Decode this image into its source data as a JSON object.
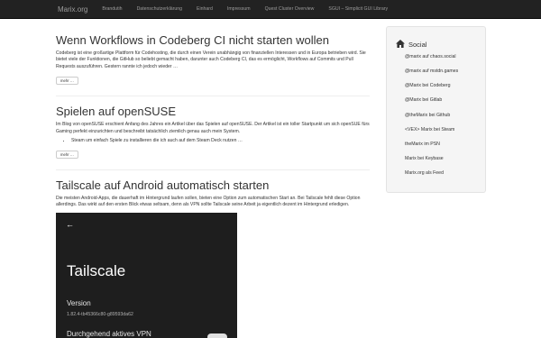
{
  "navbar": {
    "brand": "Marix.org",
    "links": [
      "Brandutih",
      "Datenschutzerklärung",
      "Einhard",
      "Impressum",
      "Quest Cluster Overview",
      "SGUI – Simplicit GUI Library"
    ]
  },
  "posts": [
    {
      "title": "Wenn Workflows in Codeberg CI nicht starten wollen",
      "text": "Codeberg ist eine großartige Plattform für Codehosting, die durch einen Verein unabhängig von finanziellen Interessen und in Europa betrieben wird. Sie bietet viele der Funktionen, die GitHub so beliebt gemacht haben, darunter auch Codeberg CI, das es ermöglicht, Workflows auf Commits und Pull Requests auszuführen. Gestern rannte ich jedoch wieder …",
      "more": "mehr …"
    },
    {
      "title": "Spielen auf openSUSE",
      "text": "Im Blog von openSUSE erschient Anfang des Jahres ein Artikel über das Spielen auf openSUSE. Der Artikel ist ein toller Startpunkt um sich openSUE fürs Gaming perfekt einzurichten und beschreibt tatsächlich ziemlich genau auch mein System.",
      "bullet": "Steam um einfach Spiele zu installieren die ich auch auf dem Steam Deck nutzen …",
      "more": "mehr …"
    },
    {
      "title": "Tailscale auf Android automatisch starten",
      "text": "Die meisten Android-Apps, die dauerhaft im Hintergrund laufen sollen, bieten eine Option zum automatischen Start an. Bei Tailscale fehlt diese Option allerdings. Das wirkt auf den ersten Blick etwas seltsam, denn als VPN sollte Tailscale seine Arbeit ja eigentlich dezent im Hintergrund erledigen."
    }
  ],
  "screenshot": {
    "back": "←",
    "app_title": "Tailscale",
    "version_label": "Version",
    "version_value": "1.82.4-tb45366c80-g89593da62",
    "cut_label": "Durchgehend aktives VPN"
  },
  "sidebar": {
    "title": "Social",
    "icon": "home-icon",
    "items": [
      "@marix auf chaos.social",
      "@marix auf mstdn.games",
      "@Marix bei Codeberg",
      "@Marix bei Gitlab",
      "@theMarix bei Github",
      "<VEX> Marix bei Steam",
      "theMarix im PSN",
      "Marix bei Keybase",
      "Marix.org als Feed"
    ]
  }
}
